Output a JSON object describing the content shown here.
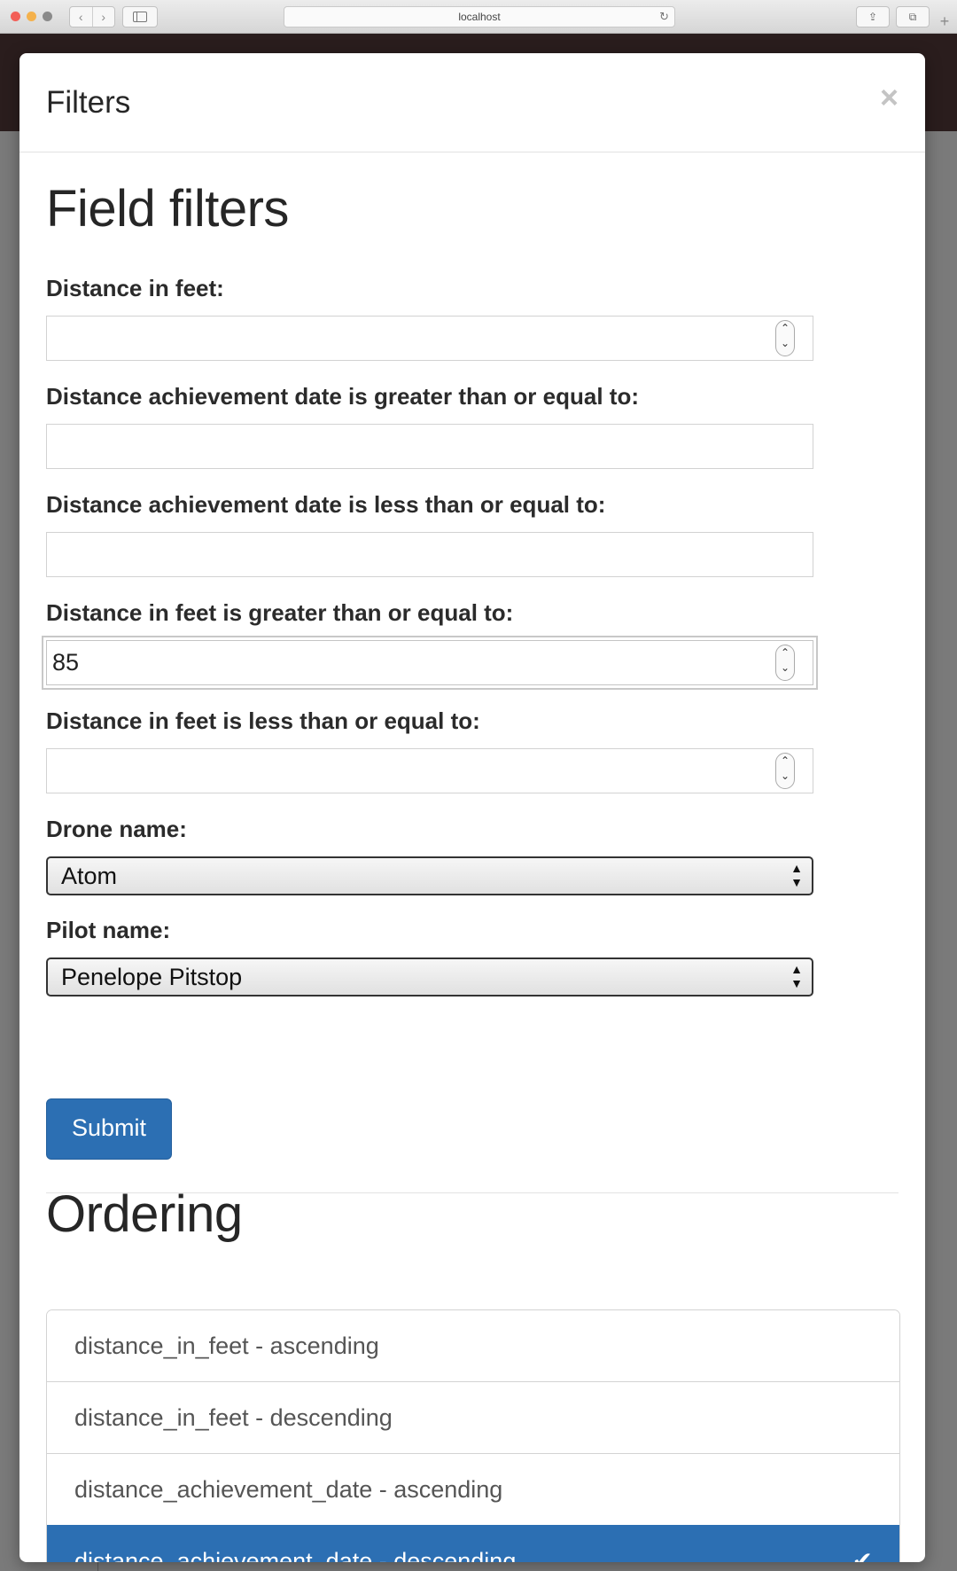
{
  "browser": {
    "address": "localhost",
    "icons": {
      "back": "chevron-left-icon",
      "forward": "chevron-right-icon",
      "sidebar": "sidebar-icon",
      "reload": "reload-icon",
      "share": "share-icon",
      "tabs": "tabs-icon",
      "new_tab": "plus-icon"
    }
  },
  "modal": {
    "title": "Filters",
    "close_glyph": "×"
  },
  "field_filters": {
    "heading": "Field filters",
    "fields": [
      {
        "label": "Distance in feet:",
        "value": "",
        "type": "number"
      },
      {
        "label": "Distance achievement date is greater than or equal to:",
        "value": "",
        "type": "text"
      },
      {
        "label": "Distance achievement date is less than or equal to:",
        "value": "",
        "type": "text"
      },
      {
        "label": "Distance in feet is greater than or equal to:",
        "value": "85",
        "type": "number"
      },
      {
        "label": "Distance in feet is less than or equal to:",
        "value": "",
        "type": "number"
      }
    ],
    "drone": {
      "label": "Drone name:",
      "selected": "Atom"
    },
    "pilot": {
      "label": "Pilot name:",
      "selected": "Penelope Pitstop"
    },
    "submit_label": "Submit"
  },
  "ordering": {
    "heading": "Ordering",
    "options": [
      {
        "label": "distance_in_feet - ascending",
        "active": false
      },
      {
        "label": "distance_in_feet - descending",
        "active": false
      },
      {
        "label": "distance_achievement_date - ascending",
        "active": false
      },
      {
        "label": "distance_achievement_date - descending",
        "active": true
      }
    ]
  },
  "colors": {
    "primary": "#2c6fb3",
    "navbar": "#2a1d1d"
  }
}
